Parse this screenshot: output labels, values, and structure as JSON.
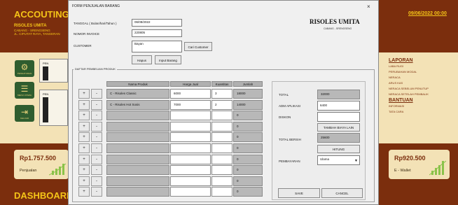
{
  "background": {
    "app_title": "ACCOUTING MA",
    "company": "RISOLES UMITA",
    "address_line1": "CABANG - SRENGSENG",
    "address_line2": "JL. CIPUTAT RAYA, TANGERAN",
    "date_link": "09/06/2022 00:00",
    "sidebar": [
      {
        "label": "PENGATURAN",
        "icon": "gear-icon",
        "glyph": "⚙"
      },
      {
        "label": "MENU UTAMA",
        "icon": "menu-icon",
        "glyph": "☰"
      },
      {
        "label": "KELUAR",
        "icon": "exit-icon",
        "glyph": "⇥"
      }
    ],
    "hidden_frame_labels": [
      "PEN",
      "PEN"
    ],
    "laporan_title": "LAPORAN",
    "laporan_items": [
      "LABA RUGI",
      "PERUBAHAN MODAL",
      "NERACA",
      "ARUS KAS",
      "NERACA SEBELUM PENUTUP",
      "NERACA SETELAH PEMBALIK"
    ],
    "bantuan_title": "BANTUAN",
    "bantuan_items": [
      "INFORMASI",
      "TATA CARA"
    ],
    "card_left": {
      "amount": "Rp1.757.500",
      "label": "Penjualan"
    },
    "card_right": {
      "amount": "Rp920.500",
      "label": "E - Wallet"
    },
    "dashboard_label": "DASHBOARI"
  },
  "dialog": {
    "title": "FORM PENJUALAN BARANG",
    "close": "×",
    "shop_name": "RISOLES UMITA",
    "shop_sub": "CABANG - SRENGSENG",
    "fields": {
      "tanggal_label": "TANGGAL ( Bulan/hari/Tahun )",
      "tanggal_value": "06/08/2022",
      "invoice_label": "NOMOR INVOICE",
      "invoice_value": "220805",
      "customer_label": "CUSTOMER",
      "customer_value": "Bayan"
    },
    "buttons": {
      "cari_customer": "Cari Customer",
      "hapus": "Hapus",
      "input_barang": "Input Barang",
      "tambah_biaya": "TAMBAH BIAYA LAIN",
      "hitung": "HITUNG",
      "save": "SAVE",
      "cancel": "CANCEL"
    },
    "frame_label": "DAFTAR PEMBELIAN PRODUK",
    "columns": [
      "Nama Produk",
      "Harga Jual",
      "Kuantitas",
      "Jumlah"
    ],
    "rows": [
      {
        "name": "C - Risoles Classic",
        "price": "6000",
        "qty": "3",
        "total": "18000"
      },
      {
        "name": "C - Risoles Hot Sosis",
        "price": "7000",
        "qty": "2",
        "total": "14000"
      },
      {
        "name": "",
        "price": "",
        "qty": "",
        "total": "0"
      },
      {
        "name": "",
        "price": "",
        "qty": "",
        "total": "0"
      },
      {
        "name": "",
        "price": "",
        "qty": "",
        "total": "0"
      },
      {
        "name": "",
        "price": "",
        "qty": "",
        "total": "0"
      },
      {
        "name": "",
        "price": "",
        "qty": "",
        "total": "0"
      },
      {
        "name": "",
        "price": "",
        "qty": "",
        "total": "0"
      },
      {
        "name": "",
        "price": "",
        "qty": "",
        "total": "0"
      },
      {
        "name": "",
        "price": "",
        "qty": "",
        "total": "0"
      }
    ],
    "plus": "+",
    "minus": "-",
    "summary": {
      "total_label": "TOTAL",
      "total_value": "32000",
      "adm_label": "ADM APLIKASI",
      "adm_value": "6400",
      "diskon_label": "DISKON",
      "diskon_value": "",
      "total_bersih_label": "TOTAL BERSIH",
      "total_bersih_value": "25600",
      "pembayaran_label": "PEMBAYARAN",
      "pembayaran_value": "Ulama"
    }
  }
}
